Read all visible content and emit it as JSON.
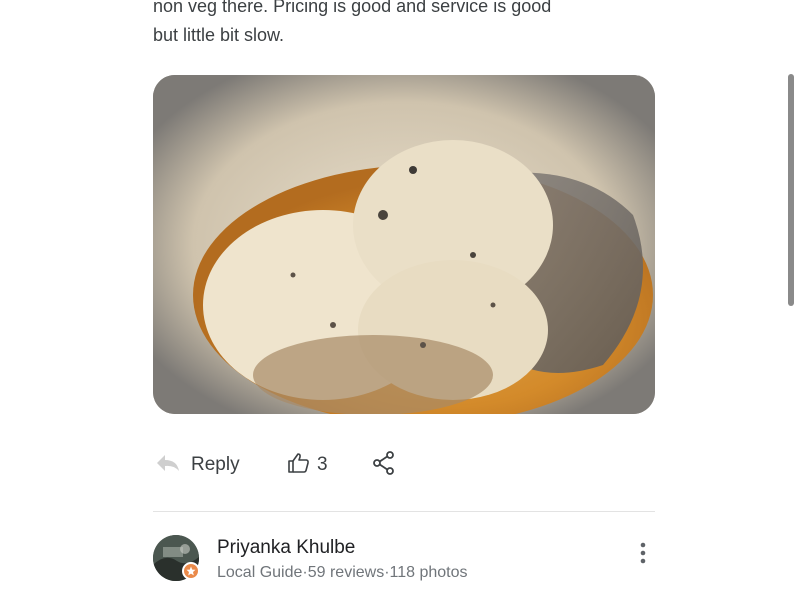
{
  "review": {
    "text_line1": "non veg there. Pricing is good and service is good",
    "text_line2": "but little bit slow."
  },
  "photo": {
    "description_icon": "food-photo"
  },
  "actions": {
    "reply_label": "Reply",
    "like_count": "3",
    "reply_icon": "reply-arrow-icon",
    "like_icon": "thumbs-up-icon",
    "share_icon": "share-icon"
  },
  "author": {
    "name": "Priyanka Khulbe",
    "meta": "Local Guide·59 reviews·118 photos",
    "badge_icon": "local-guide-star-icon",
    "more_icon": "more-vert-icon"
  },
  "colors": {
    "text": "#3c4043",
    "meta": "#70757a",
    "badge": "#ea8a4a",
    "divider": "#e3e3e3"
  }
}
